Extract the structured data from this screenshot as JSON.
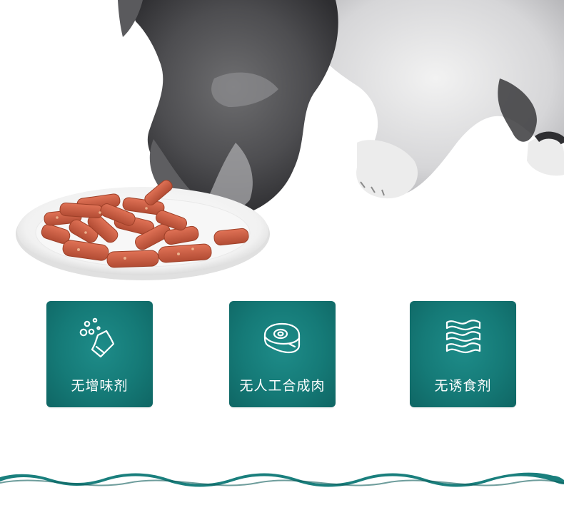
{
  "hero": {
    "image": "schnauzer-dog-eating-sausage-sticks-from-plate"
  },
  "features": [
    {
      "label": "无增味剂",
      "icon": "bubbles-bottle-icon"
    },
    {
      "label": "无人工合成肉",
      "icon": "meat-steak-icon"
    },
    {
      "label": "无诱食剂",
      "icon": "wavy-lines-icon"
    }
  ],
  "colors": {
    "badge": "#157a77",
    "wave": "#1a7f7d",
    "background": "#ffffff"
  }
}
